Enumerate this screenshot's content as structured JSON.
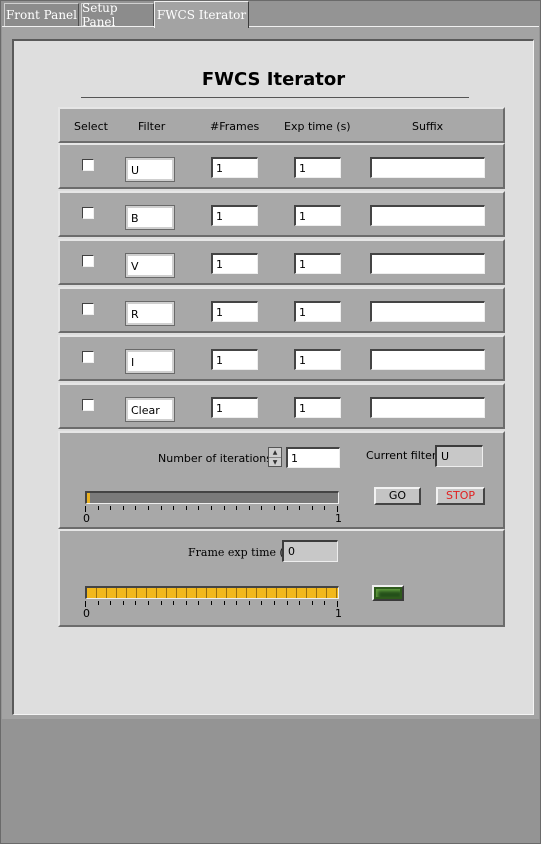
{
  "tabs": [
    "Front Panel",
    "Setup Panel",
    "FWCS Iterator"
  ],
  "active_tab": 2,
  "title": "FWCS Iterator",
  "columns": [
    "Select",
    "Filter",
    "#Frames",
    "Exp time (s)",
    "Suffix"
  ],
  "rows": [
    {
      "selected": false,
      "filter": "U",
      "frames": "1",
      "exp_time": "1",
      "suffix": ""
    },
    {
      "selected": false,
      "filter": "B",
      "frames": "1",
      "exp_time": "1",
      "suffix": ""
    },
    {
      "selected": false,
      "filter": "V",
      "frames": "1",
      "exp_time": "1",
      "suffix": ""
    },
    {
      "selected": false,
      "filter": "R",
      "frames": "1",
      "exp_time": "1",
      "suffix": ""
    },
    {
      "selected": false,
      "filter": "I",
      "frames": "1",
      "exp_time": "1",
      "suffix": ""
    },
    {
      "selected": false,
      "filter": "Clear",
      "frames": "1",
      "exp_time": "1",
      "suffix": ""
    }
  ],
  "controls": {
    "iterations_label": "Number of iterations",
    "iterations_value": "1",
    "current_filter_label": "Current filter",
    "current_filter_value": "U",
    "go_label": "GO",
    "stop_label": "STOP",
    "iteration_progress": {
      "min_label": "0",
      "max_label": "1",
      "fraction": 0.0
    },
    "frame_exp_label": "Frame exp time (s)",
    "frame_exp_value": "0",
    "frame_progress": {
      "min_label": "0",
      "max_label": "1",
      "fraction": 1.0
    }
  },
  "colors": {
    "iteration_bar_fill": "#e8b020",
    "iteration_bar_bg": "#7a7a7a",
    "frame_bar_fill": "#f2b81c",
    "stop_text": "#e02020",
    "led": "#2e5a1c"
  }
}
